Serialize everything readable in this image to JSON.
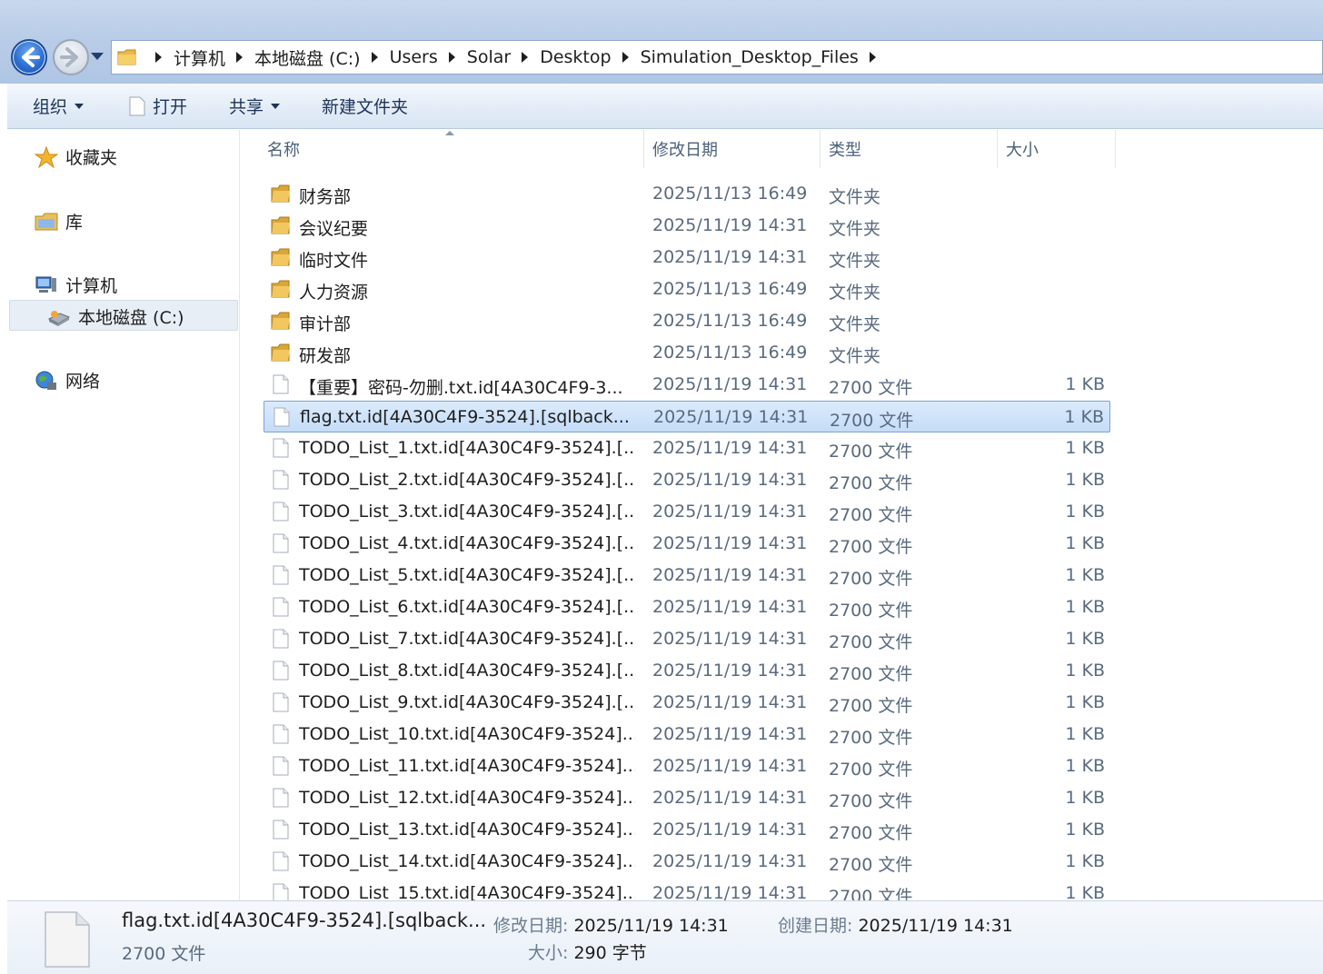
{
  "breadcrumb": [
    "计算机",
    "本地磁盘 (C:)",
    "Users",
    "Solar",
    "Desktop",
    "Simulation_Desktop_Files"
  ],
  "toolbar": {
    "organize": "组织",
    "open": "打开",
    "share": "共享",
    "new_folder": "新建文件夹"
  },
  "nav": {
    "favorites": "收藏夹",
    "libraries": "库",
    "computer": "计算机",
    "local_disk": "本地磁盘 (C:)",
    "network": "网络"
  },
  "columns": {
    "name": "名称",
    "date": "修改日期",
    "type": "类型",
    "size": "大小"
  },
  "files": [
    {
      "name": "财务部",
      "date": "2025/11/13 16:49",
      "type": "文件夹",
      "size": "",
      "kind": "folder"
    },
    {
      "name": "会议纪要",
      "date": "2025/11/19 14:31",
      "type": "文件夹",
      "size": "",
      "kind": "folder"
    },
    {
      "name": "临时文件",
      "date": "2025/11/19 14:31",
      "type": "文件夹",
      "size": "",
      "kind": "folder"
    },
    {
      "name": "人力资源",
      "date": "2025/11/13 16:49",
      "type": "文件夹",
      "size": "",
      "kind": "folder"
    },
    {
      "name": "审计部",
      "date": "2025/11/13 16:49",
      "type": "文件夹",
      "size": "",
      "kind": "folder"
    },
    {
      "name": "研发部",
      "date": "2025/11/13 16:49",
      "type": "文件夹",
      "size": "",
      "kind": "folder"
    },
    {
      "name": "【重要】密码-勿删.txt.id[4A30C4F9-3...",
      "date": "2025/11/19 14:31",
      "type": "2700 文件",
      "size": "1 KB",
      "kind": "file"
    },
    {
      "name": "flag.txt.id[4A30C4F9-3524].[sqlback...",
      "date": "2025/11/19 14:31",
      "type": "2700 文件",
      "size": "1 KB",
      "kind": "file",
      "selected": true
    },
    {
      "name": "TODO_List_1.txt.id[4A30C4F9-3524].[...",
      "date": "2025/11/19 14:31",
      "type": "2700 文件",
      "size": "1 KB",
      "kind": "file"
    },
    {
      "name": "TODO_List_2.txt.id[4A30C4F9-3524].[...",
      "date": "2025/11/19 14:31",
      "type": "2700 文件",
      "size": "1 KB",
      "kind": "file"
    },
    {
      "name": "TODO_List_3.txt.id[4A30C4F9-3524].[...",
      "date": "2025/11/19 14:31",
      "type": "2700 文件",
      "size": "1 KB",
      "kind": "file"
    },
    {
      "name": "TODO_List_4.txt.id[4A30C4F9-3524].[...",
      "date": "2025/11/19 14:31",
      "type": "2700 文件",
      "size": "1 KB",
      "kind": "file"
    },
    {
      "name": "TODO_List_5.txt.id[4A30C4F9-3524].[...",
      "date": "2025/11/19 14:31",
      "type": "2700 文件",
      "size": "1 KB",
      "kind": "file"
    },
    {
      "name": "TODO_List_6.txt.id[4A30C4F9-3524].[...",
      "date": "2025/11/19 14:31",
      "type": "2700 文件",
      "size": "1 KB",
      "kind": "file"
    },
    {
      "name": "TODO_List_7.txt.id[4A30C4F9-3524].[...",
      "date": "2025/11/19 14:31",
      "type": "2700 文件",
      "size": "1 KB",
      "kind": "file"
    },
    {
      "name": "TODO_List_8.txt.id[4A30C4F9-3524].[...",
      "date": "2025/11/19 14:31",
      "type": "2700 文件",
      "size": "1 KB",
      "kind": "file"
    },
    {
      "name": "TODO_List_9.txt.id[4A30C4F9-3524].[...",
      "date": "2025/11/19 14:31",
      "type": "2700 文件",
      "size": "1 KB",
      "kind": "file"
    },
    {
      "name": "TODO_List_10.txt.id[4A30C4F9-3524]...",
      "date": "2025/11/19 14:31",
      "type": "2700 文件",
      "size": "1 KB",
      "kind": "file"
    },
    {
      "name": "TODO_List_11.txt.id[4A30C4F9-3524]...",
      "date": "2025/11/19 14:31",
      "type": "2700 文件",
      "size": "1 KB",
      "kind": "file"
    },
    {
      "name": "TODO_List_12.txt.id[4A30C4F9-3524]...",
      "date": "2025/11/19 14:31",
      "type": "2700 文件",
      "size": "1 KB",
      "kind": "file"
    },
    {
      "name": "TODO_List_13.txt.id[4A30C4F9-3524]...",
      "date": "2025/11/19 14:31",
      "type": "2700 文件",
      "size": "1 KB",
      "kind": "file"
    },
    {
      "name": "TODO_List_14.txt.id[4A30C4F9-3524]...",
      "date": "2025/11/19 14:31",
      "type": "2700 文件",
      "size": "1 KB",
      "kind": "file"
    },
    {
      "name": "TODO_List_15.txt.id[4A30C4F9-3524]...",
      "date": "2025/11/19 14:31",
      "type": "2700 文件",
      "size": "1 KB",
      "kind": "file"
    }
  ],
  "details": {
    "name": "flag.txt.id[4A30C4F9-3524].[sqlback...",
    "type": "2700 文件",
    "modified_label": "修改日期:",
    "modified_value": "2025/11/19 14:31",
    "created_label": "创建日期:",
    "created_value": "2025/11/19 14:31",
    "size_label": "大小:",
    "size_value": "290 字节"
  },
  "icons": {
    "back": "back-arrow-icon",
    "forward": "forward-arrow-icon",
    "folder": "folder-icon",
    "file": "file-icon",
    "favorites": "star-icon",
    "libraries": "library-icon",
    "computer": "computer-icon",
    "disk": "disk-icon",
    "network": "network-icon"
  }
}
